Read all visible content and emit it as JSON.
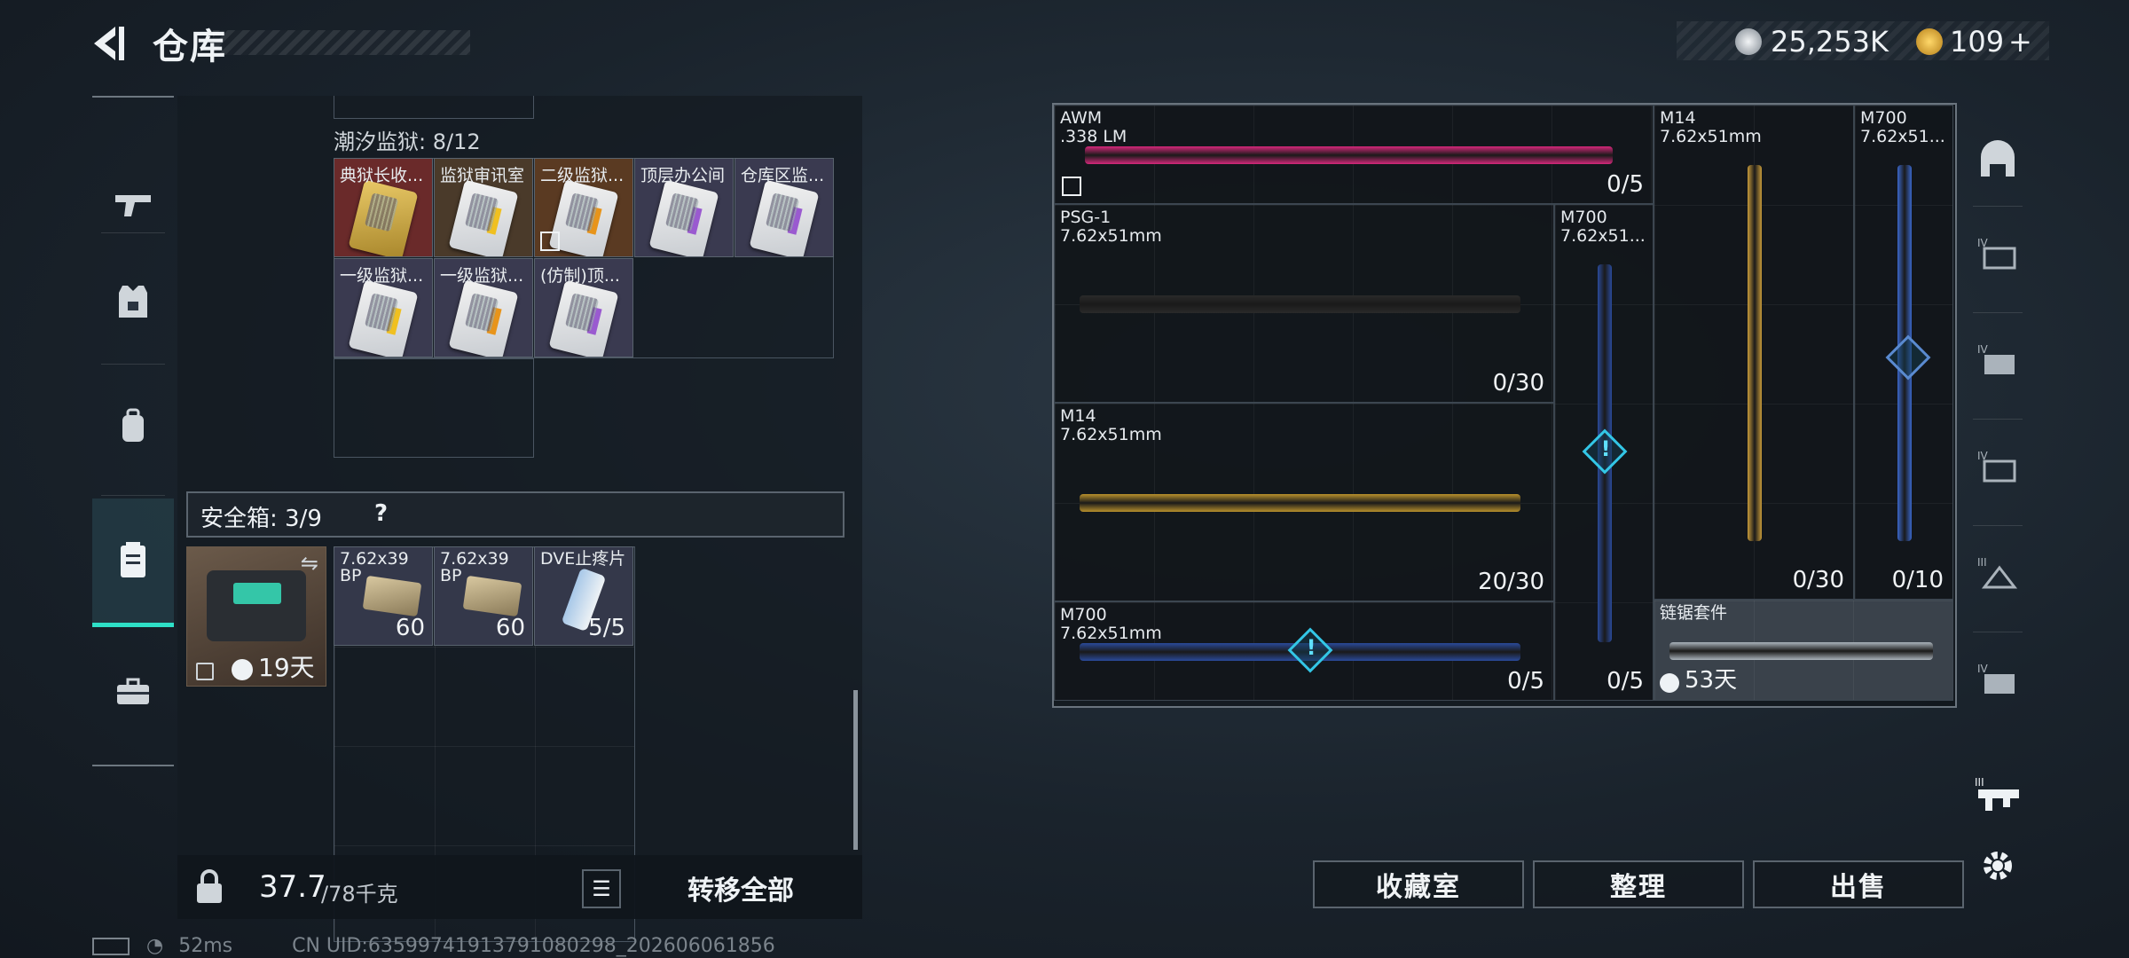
{
  "header": {
    "title": "仓库"
  },
  "currency": {
    "coins": "25,253K",
    "gems": "109",
    "plus": "+"
  },
  "left_panel": {
    "section_title": "潮汐监狱: 8/12",
    "cards": [
      {
        "label": "典狱长收...",
        "style": "gold",
        "bg": "#6a2a2a"
      },
      {
        "label": "监狱审讯室",
        "style": "stripe-y",
        "bg": "#4a3a2a"
      },
      {
        "label": "二级监狱...",
        "style": "stripe-o",
        "bg": "#5a3a22"
      },
      {
        "label": "顶层办公间",
        "style": "stripe-p",
        "bg": "#3a3a50"
      },
      {
        "label": "仓库区监...",
        "style": "stripe-p",
        "bg": "#3a3a50"
      },
      {
        "label": "一级监狱...",
        "style": "stripe-y",
        "bg": "#3a3a50"
      },
      {
        "label": "一级监狱...",
        "style": "stripe-o",
        "bg": "#3a3a50"
      },
      {
        "label": "(仿制)顶...",
        "style": "stripe-p",
        "bg": "#3a3a50"
      }
    ],
    "safebox": {
      "label": "安全箱: 3/9",
      "help": "?",
      "timer": "19天"
    },
    "safebox_items": [
      {
        "label": "7.62x39\nBP",
        "count": "60"
      },
      {
        "label": "7.62x39\nBP",
        "count": "60"
      },
      {
        "label": "DVE止疼片",
        "count": "5/5"
      }
    ],
    "weight": {
      "current": "37.7",
      "max": "/78千克"
    },
    "transfer_all": "转移全部"
  },
  "weapons": [
    {
      "name": "AWM",
      "ammo": ".338 LM",
      "count": "0/5"
    },
    {
      "name": "M14",
      "ammo": "7.62x51mm",
      "count": "0/30"
    },
    {
      "name": "M700",
      "ammo": "7.62x51...",
      "count": "0/10"
    },
    {
      "name": "PSG-1",
      "ammo": "7.62x51mm",
      "count": "0/30"
    },
    {
      "name": "M700",
      "ammo": "7.62x51...",
      "count": "0/5"
    },
    {
      "name": "M14",
      "ammo": "7.62x51mm",
      "count": "20/30"
    },
    {
      "name": "M700",
      "ammo": "7.62x51mm",
      "count": "0/5"
    },
    {
      "name": "链锯套件",
      "ammo": "",
      "count": "53天"
    }
  ],
  "buttons": {
    "collection": "收藏室",
    "organize": "整理",
    "sell": "出售"
  },
  "status": {
    "ping": "52ms",
    "uid": "CN UID:63599741913791080298_202606061856"
  }
}
